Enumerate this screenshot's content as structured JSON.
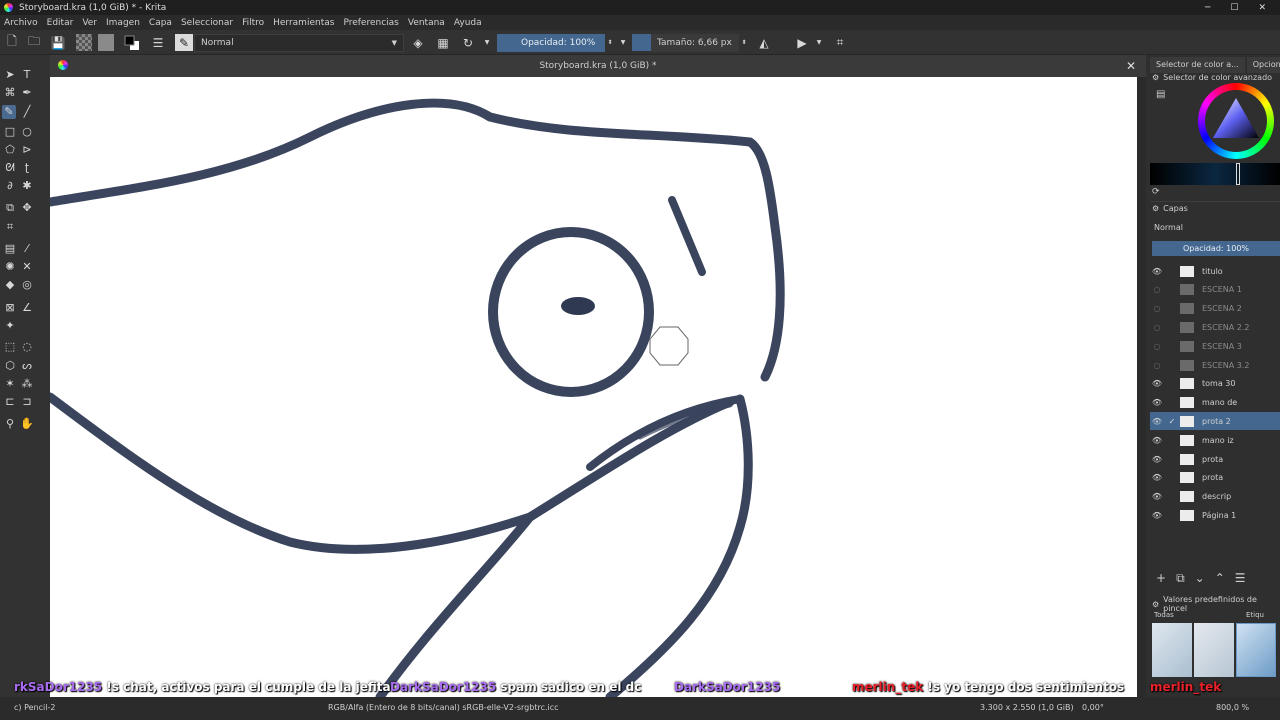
{
  "window": {
    "title": "Storyboard.kra (1,0 GiB) * - Krita",
    "minimize": "─",
    "maximize": "☐",
    "close": "✕"
  },
  "menu": [
    "Archivo",
    "Editar",
    "Ver",
    "Imagen",
    "Capa",
    "Seleccionar",
    "Filtro",
    "Herramientas",
    "Preferencias",
    "Ventana",
    "Ayuda"
  ],
  "toolbar": {
    "blend_mode": "Normal",
    "opacity_label": "Opacidad: 100%",
    "size_label": "Tamaño: 6,66 px"
  },
  "document": {
    "tab_title": "Storyboard.kra (1,0 GiB) *"
  },
  "dockers": {
    "tabs": [
      "Selector de color a...",
      "Opcione"
    ],
    "color_selector_title": "Selector de color avanzado",
    "layers_title": "Capas",
    "layers_blend": "Normal",
    "layers_opacity": "Opacidad:  100%",
    "layers": [
      {
        "name": "titulo",
        "visible": true,
        "dim": false,
        "selected": false
      },
      {
        "name": "ESCENA 1",
        "visible": false,
        "dim": true,
        "selected": false
      },
      {
        "name": "ESCENA 2",
        "visible": false,
        "dim": true,
        "selected": false
      },
      {
        "name": "ESCENA 2.2",
        "visible": false,
        "dim": true,
        "selected": false
      },
      {
        "name": "ESCENA 3",
        "visible": false,
        "dim": true,
        "selected": false
      },
      {
        "name": "ESCENA 3.2",
        "visible": false,
        "dim": true,
        "selected": false
      },
      {
        "name": "toma 30",
        "visible": true,
        "dim": false,
        "selected": false
      },
      {
        "name": "mano de",
        "visible": true,
        "dim": false,
        "selected": false
      },
      {
        "name": "prota 2",
        "visible": true,
        "dim": false,
        "selected": true
      },
      {
        "name": "mano iz",
        "visible": true,
        "dim": false,
        "selected": false
      },
      {
        "name": "prota",
        "visible": true,
        "dim": false,
        "selected": false
      },
      {
        "name": "prota",
        "visible": true,
        "dim": false,
        "selected": false
      },
      {
        "name": "descrip",
        "visible": true,
        "dim": false,
        "selected": false
      },
      {
        "name": "Página 1",
        "visible": true,
        "dim": false,
        "selected": false
      }
    ],
    "brush_presets_title": "Valores predefinidos de pincel",
    "brush_filter": "Todas",
    "brush_tag": "Etiqu"
  },
  "chat": [
    {
      "user": "rkSaDor1235",
      "msg": "!s chat, activos para el cumple de la jefita",
      "color": "#a86cf0"
    },
    {
      "user": "DarkSaDor1235",
      "msg": "spam sadico en el dc",
      "color": "#a86cf0"
    },
    {
      "user": "DarkSaDor1235",
      "msg": "",
      "color": "#a86cf0"
    },
    {
      "user": "merlin_tek",
      "msg": "!s yo tengo dos sentimientos",
      "color": "#e8222a"
    },
    {
      "user": "merlin_tek",
      "msg": "",
      "color": "#e8222a"
    }
  ],
  "status": {
    "tool": "c) Pencil-2",
    "color_profile": "RGB/Alfa (Entero de 8 bits/canal)  sRGB-elle-V2-srgbtrc.icc",
    "dimensions": "3.300 x 2.550 (1,0 GiB)",
    "rotation": "0,00°",
    "zoom": "800,0 %"
  }
}
